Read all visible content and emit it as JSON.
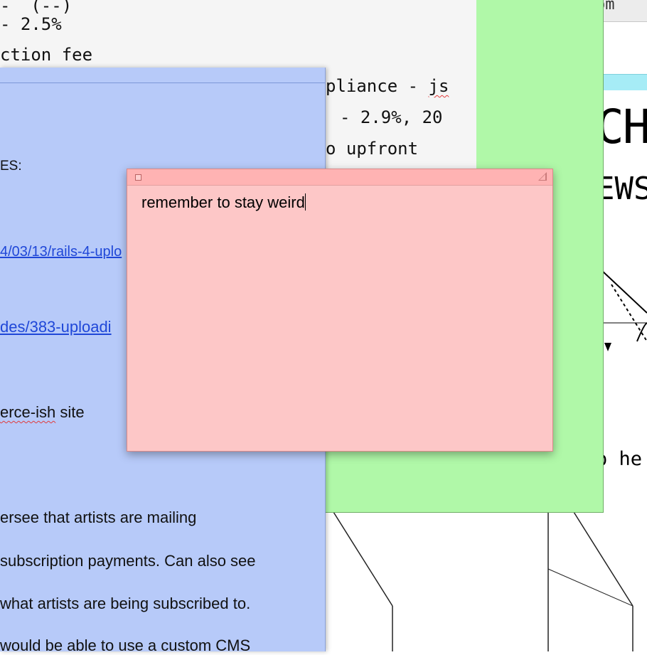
{
  "code_window": {
    "lines": [
      "- 2.5%",
      "ction fee",
      "pliance - js",
      "- 2.9%, 20",
      "o upfront"
    ]
  },
  "right_window": {
    "title_fragment": "om",
    "big_text_1": "CH",
    "big_text_2": "EWS",
    "bottom_fragment": "o he"
  },
  "blue_note": {
    "line_es": "ES:",
    "link_1": "4/03/13/rails-4-uplo",
    "link_2": "des/383-uploadi",
    "line_commerce_word": "erce-ish",
    "line_commerce_rest": " site",
    "line_oversee": "ersee that artists are mailing",
    "line_subscription": "subscription payments. Can also see",
    "line_what": "what artists are being subscribed to.",
    "line_would": "would be able to use a custom CMS"
  },
  "pink_note": {
    "text": "remember to stay weird"
  },
  "colors": {
    "pink_note": "#fdc7c7",
    "blue_note": "#b7caf9",
    "green_note": "#b0f8a8",
    "yellow_note": "#fdf0a0",
    "link": "#1f47d8"
  }
}
